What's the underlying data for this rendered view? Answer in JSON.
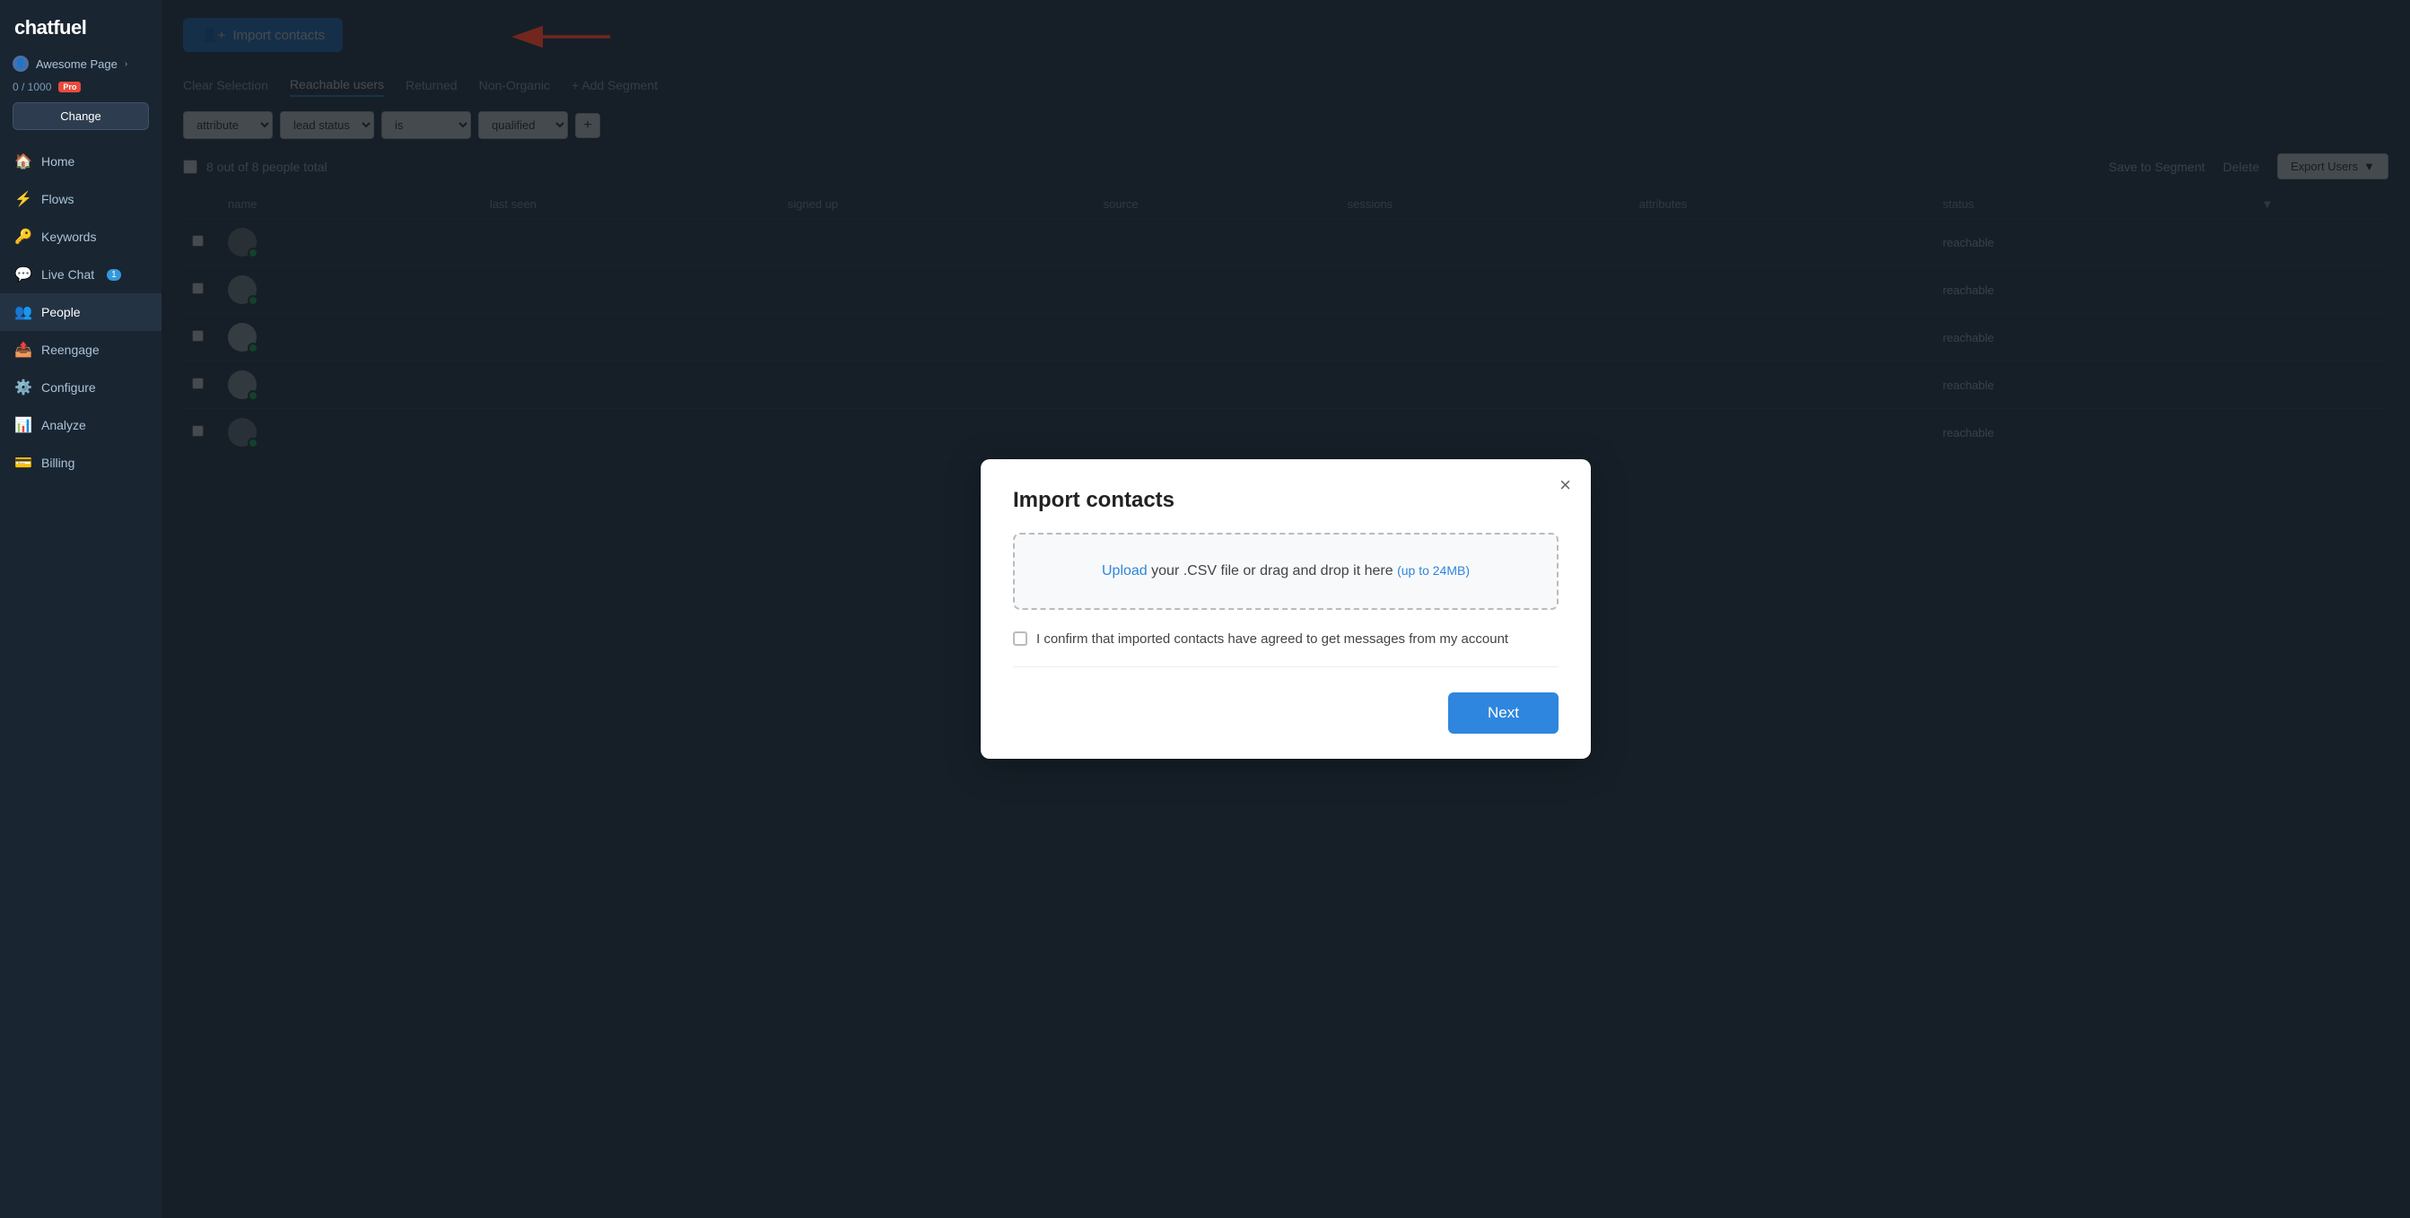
{
  "sidebar": {
    "logo": "chatfuel",
    "account": {
      "name": "Awesome Page",
      "icon": "👤"
    },
    "pro_count": "0 / 1000",
    "pro_badge": "Pro",
    "change_label": "Change",
    "items": [
      {
        "id": "home",
        "label": "Home",
        "icon": "🏠",
        "active": false,
        "badge": null
      },
      {
        "id": "flows",
        "label": "Flows",
        "icon": "⚡",
        "active": false,
        "badge": null
      },
      {
        "id": "keywords",
        "label": "Keywords",
        "icon": "🔑",
        "active": false,
        "badge": null
      },
      {
        "id": "livechat",
        "label": "Live Chat",
        "icon": "💬",
        "active": false,
        "badge": "1"
      },
      {
        "id": "people",
        "label": "People",
        "icon": "👥",
        "active": true,
        "badge": null
      },
      {
        "id": "reengage",
        "label": "Reengage",
        "icon": "📤",
        "active": false,
        "badge": null
      },
      {
        "id": "configure",
        "label": "Configure",
        "icon": "⚙️",
        "active": false,
        "badge": null
      },
      {
        "id": "analyze",
        "label": "Analyze",
        "icon": "📊",
        "active": false,
        "badge": null
      },
      {
        "id": "billing",
        "label": "Billing",
        "icon": "💳",
        "active": false,
        "badge": null
      }
    ]
  },
  "toolbar": {
    "import_label": "Import contacts"
  },
  "segments": {
    "clear": "Clear Selection",
    "reachable": "Reachable users",
    "returned": "Returned",
    "nonorganic": "Non-Organic",
    "add": "+ Add Segment"
  },
  "filter": {
    "field1": "attribute",
    "field2": "lead status",
    "field3": "is",
    "field4": "qualified"
  },
  "people_count": "8 out of 8 people total",
  "actions": {
    "save_segment": "Save to Segment",
    "delete": "Delete",
    "export": "Export Users"
  },
  "table": {
    "columns": [
      "",
      "name",
      "last seen",
      "signed up",
      "source",
      "sessions",
      "attributes",
      "status",
      ""
    ],
    "rows": [
      {
        "status": "reachable"
      },
      {
        "status": "reachable"
      },
      {
        "status": "reachable"
      },
      {
        "status": "reachable"
      },
      {
        "status": "reachable"
      }
    ]
  },
  "modal": {
    "title": "Import contacts",
    "close_icon": "×",
    "upload_text": "your .CSV file or drag and drop it here",
    "upload_link": "Upload",
    "size_hint": "(up to 24MB)",
    "confirm_text": "I confirm that imported contacts have agreed to get messages from my account",
    "next_label": "Next"
  }
}
